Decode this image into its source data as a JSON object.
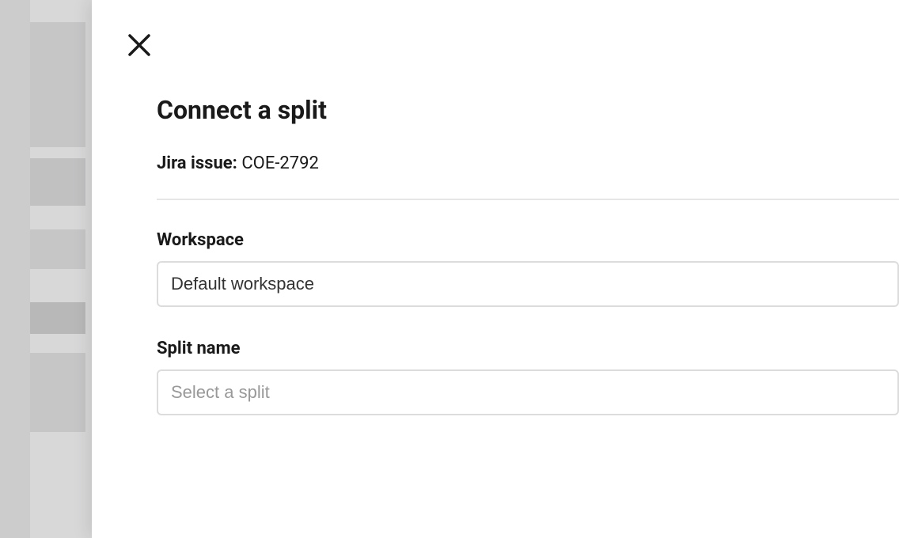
{
  "dialog": {
    "title": "Connect a split",
    "jira_label": "Jira issue:",
    "jira_value": "COE-2792"
  },
  "fields": {
    "workspace": {
      "label": "Workspace",
      "value": "Default workspace"
    },
    "split_name": {
      "label": "Split name",
      "placeholder": "Select a split"
    }
  }
}
